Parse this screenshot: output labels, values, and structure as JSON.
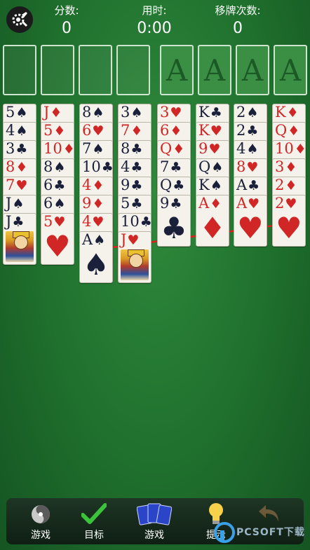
{
  "header": {
    "score_label": "分数:",
    "score_value": "0",
    "time_label": "用时:",
    "time_value": "0:00",
    "moves_label": "移牌次数:",
    "moves_value": "0"
  },
  "foundations": [
    "A",
    "A",
    "A",
    "A"
  ],
  "tableau": [
    [
      {
        "rank": "5",
        "suit": "♠",
        "color": "black"
      },
      {
        "rank": "4",
        "suit": "♠",
        "color": "black"
      },
      {
        "rank": "3",
        "suit": "♣",
        "color": "black"
      },
      {
        "rank": "8",
        "suit": "♦",
        "color": "red"
      },
      {
        "rank": "7",
        "suit": "♥",
        "color": "red"
      },
      {
        "rank": "J",
        "suit": "♠",
        "color": "black"
      },
      {
        "rank": "J",
        "suit": "♣",
        "color": "black",
        "face": true
      }
    ],
    [
      {
        "rank": "J",
        "suit": "♦",
        "color": "red"
      },
      {
        "rank": "5",
        "suit": "♦",
        "color": "red"
      },
      {
        "rank": "10",
        "suit": "♦",
        "color": "red"
      },
      {
        "rank": "8",
        "suit": "♠",
        "color": "black"
      },
      {
        "rank": "6",
        "suit": "♣",
        "color": "black"
      },
      {
        "rank": "6",
        "suit": "♠",
        "color": "black"
      },
      {
        "rank": "5",
        "suit": "♥",
        "color": "red"
      }
    ],
    [
      {
        "rank": "8",
        "suit": "♠",
        "color": "black"
      },
      {
        "rank": "6",
        "suit": "♥",
        "color": "red"
      },
      {
        "rank": "7",
        "suit": "♠",
        "color": "black"
      },
      {
        "rank": "10",
        "suit": "♣",
        "color": "black"
      },
      {
        "rank": "4",
        "suit": "♦",
        "color": "red"
      },
      {
        "rank": "9",
        "suit": "♦",
        "color": "red"
      },
      {
        "rank": "4",
        "suit": "♥",
        "color": "red"
      },
      {
        "rank": "A",
        "suit": "♠",
        "color": "black"
      }
    ],
    [
      {
        "rank": "3",
        "suit": "♠",
        "color": "black"
      },
      {
        "rank": "7",
        "suit": "♦",
        "color": "red"
      },
      {
        "rank": "8",
        "suit": "♣",
        "color": "black"
      },
      {
        "rank": "4",
        "suit": "♣",
        "color": "black"
      },
      {
        "rank": "9",
        "suit": "♣",
        "color": "black"
      },
      {
        "rank": "5",
        "suit": "♣",
        "color": "black"
      },
      {
        "rank": "10",
        "suit": "♣",
        "color": "black"
      },
      {
        "rank": "J",
        "suit": "♥",
        "color": "red",
        "face": true
      }
    ],
    [
      {
        "rank": "3",
        "suit": "♥",
        "color": "red"
      },
      {
        "rank": "6",
        "suit": "♦",
        "color": "red"
      },
      {
        "rank": "Q",
        "suit": "♦",
        "color": "red"
      },
      {
        "rank": "7",
        "suit": "♣",
        "color": "black"
      },
      {
        "rank": "Q",
        "suit": "♣",
        "color": "black"
      },
      {
        "rank": "9",
        "suit": "♣",
        "color": "black"
      }
    ],
    [
      {
        "rank": "K",
        "suit": "♣",
        "color": "black"
      },
      {
        "rank": "K",
        "suit": "♥",
        "color": "red"
      },
      {
        "rank": "9",
        "suit": "♥",
        "color": "red"
      },
      {
        "rank": "Q",
        "suit": "♠",
        "color": "black"
      },
      {
        "rank": "K",
        "suit": "♠",
        "color": "black"
      },
      {
        "rank": "A",
        "suit": "♦",
        "color": "red"
      }
    ],
    [
      {
        "rank": "2",
        "suit": "♠",
        "color": "black"
      },
      {
        "rank": "2",
        "suit": "♣",
        "color": "black"
      },
      {
        "rank": "4",
        "suit": "♠",
        "color": "black"
      },
      {
        "rank": "8",
        "suit": "♥",
        "color": "red"
      },
      {
        "rank": "A",
        "suit": "♣",
        "color": "black"
      },
      {
        "rank": "A",
        "suit": "♥",
        "color": "red"
      }
    ],
    [
      {
        "rank": "K",
        "suit": "♦",
        "color": "red"
      },
      {
        "rank": "Q",
        "suit": "♦",
        "color": "red"
      },
      {
        "rank": "10",
        "suit": "♦",
        "color": "red"
      },
      {
        "rank": "3",
        "suit": "♦",
        "color": "red"
      },
      {
        "rank": "2",
        "suit": "♦",
        "color": "red"
      },
      {
        "rank": "2",
        "suit": "♥",
        "color": "red"
      }
    ]
  ],
  "hint_arrow": {
    "from_card": "A♠",
    "to_card": "2♥",
    "color": "#e0201c"
  },
  "toolbar": [
    {
      "label": "游戏",
      "icon": "swirl-icon",
      "enabled": true
    },
    {
      "label": "目标",
      "icon": "checkmark-icon",
      "enabled": true
    },
    {
      "label": "游戏",
      "icon": "card-deck-icon",
      "enabled": true
    },
    {
      "label": "提示",
      "icon": "lightbulb-icon",
      "enabled": true
    },
    {
      "label": "",
      "icon": "undo-icon",
      "enabled": false
    }
  ],
  "watermark": "PCSOFT下载"
}
